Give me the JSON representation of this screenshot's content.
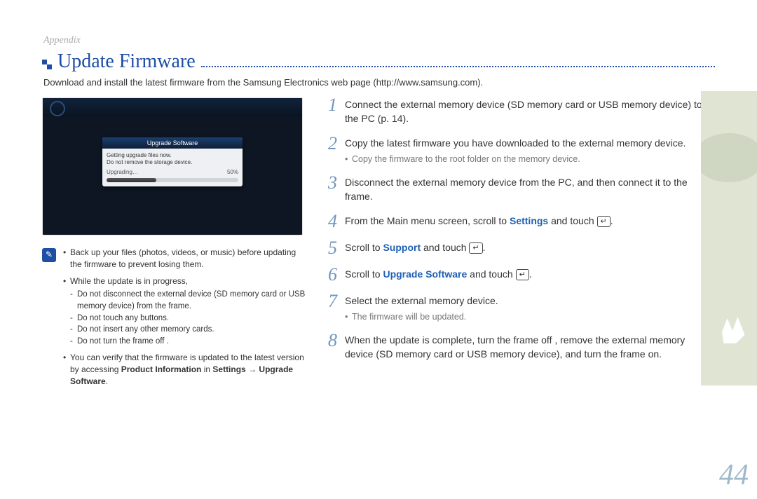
{
  "section": "Appendix",
  "title": "Update Firmware",
  "intro": "Download and install the latest firmware from the Samsung Electronics web page (http://www.samsung.com).",
  "screenshot": {
    "dialog_title": "Upgrade Software",
    "line1": "Getting upgrade files now.",
    "line2": "Do not remove the storage device.",
    "progress_label": "Upgrading…",
    "progress_pct": "50%"
  },
  "notes": {
    "n1": "Back up your files (photos, videos, or music) before updating the firmware to prevent losing them.",
    "n2": "While the update is in progress,",
    "n2a": "Do not disconnect the external device (SD memory card or USB memory device) from the frame.",
    "n2b": "Do not touch any buttons.",
    "n2c": "Do not insert any other memory cards.",
    "n2d": "Do not turn the frame off .",
    "n3_pre": "You can verify that the firmware is updated to the latest version by accessing ",
    "n3_b1": "Product Information",
    "n3_mid": " in ",
    "n3_b2": "Settings → Upgrade Software",
    "n3_post": "."
  },
  "steps": {
    "s1": "Connect the external memory device (SD memory card or USB memory device) to the PC (p. 14).",
    "s2": "Copy the latest firmware you have downloaded to the external memory device.",
    "s2_sub": "Copy the firmware to the root folder on the memory device.",
    "s3": "Disconnect the external memory device from the PC, and then connect it to the frame.",
    "s4_pre": "From the Main menu screen, scroll to ",
    "s4_hl": "Settings",
    "s4_post": " and touch ",
    "s5_pre": "Scroll to ",
    "s5_hl": "Support",
    "s5_post": " and touch ",
    "s6_pre": "Scroll to ",
    "s6_hl": "Upgrade Software",
    "s6_post": " and touch ",
    "s7": "Select the external memory device.",
    "s7_sub": "The firmware will be updated.",
    "s8": "When the update is complete, turn the frame off , remove the external memory device (SD memory card or USB memory device), and turn the frame on."
  },
  "page_number": "44",
  "enter_glyph": "↵"
}
